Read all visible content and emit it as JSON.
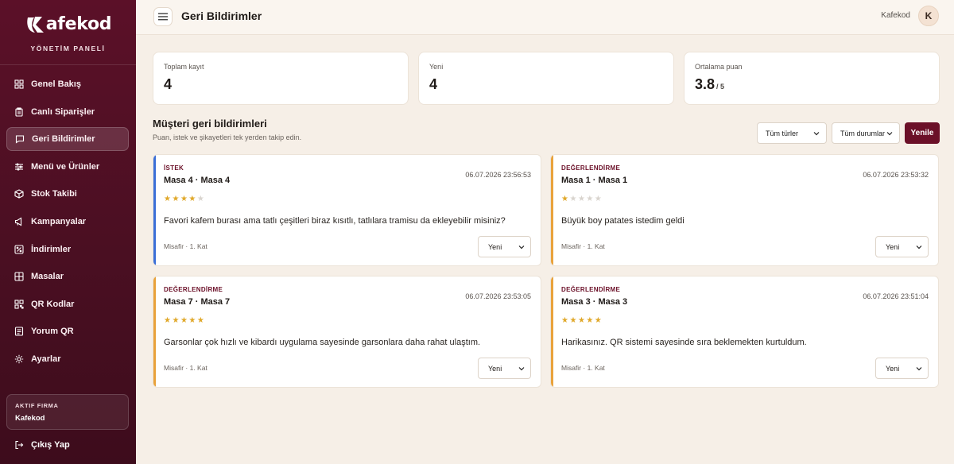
{
  "sidebar": {
    "brand": "afekod",
    "subtitle": "YÖNETİM PANELİ",
    "items": [
      {
        "label": "Genel Bakış",
        "icon": "grid-icon",
        "active": false
      },
      {
        "label": "Canlı Siparişler",
        "icon": "clipboard-icon",
        "active": false
      },
      {
        "label": "Geri Bildirimler",
        "icon": "message-icon",
        "active": true
      },
      {
        "label": "Menü ve Ürünler",
        "icon": "sliders-icon",
        "active": false
      },
      {
        "label": "Stok Takibi",
        "icon": "box-icon",
        "active": false
      },
      {
        "label": "Kampanyalar",
        "icon": "megaphone-icon",
        "active": false
      },
      {
        "label": "İndirimler",
        "icon": "discount-icon",
        "active": false
      },
      {
        "label": "Masalar",
        "icon": "table-icon",
        "active": false
      },
      {
        "label": "QR Kodlar",
        "icon": "qr-icon",
        "active": false
      },
      {
        "label": "Yorum QR",
        "icon": "comment-qr-icon",
        "active": false
      },
      {
        "label": "Ayarlar",
        "icon": "gear-icon",
        "active": false
      }
    ],
    "company_label": "AKTIF FIRMA",
    "company_name": "Kafekod",
    "logout": "Çıkış Yap"
  },
  "topbar": {
    "title": "Geri Bildirimler",
    "user": "Kafekod",
    "avatar": "K"
  },
  "stats": [
    {
      "label": "Toplam kayıt",
      "value": "4",
      "suffix": ""
    },
    {
      "label": "Yeni",
      "value": "4",
      "suffix": ""
    },
    {
      "label": "Ortalama puan",
      "value": "3.8",
      "suffix": "/ 5"
    }
  ],
  "section": {
    "title": "Müşteri geri bildirimleri",
    "subtitle": "Puan, istek ve şikayetleri tek yerden takip edin.",
    "filter_types": "Tüm türler",
    "filter_status": "Tüm durumlar",
    "refresh": "Yenile"
  },
  "cards": [
    {
      "type": "İSTEK",
      "title": "Masa 4 · Masa 4",
      "date": "06.07.2026 23:56:53",
      "rating": 4,
      "text": "Favori kafem burası ama tatlı çeşitleri biraz kısıtlı, tatlılara tramisu da ekleyebilir misiniz?",
      "meta": "Misafir · 1. Kat",
      "status": "Yeni",
      "accent": "#3b6fd8"
    },
    {
      "type": "DEĞERLENDİRME",
      "title": "Masa 1 · Masa 1",
      "date": "06.07.2026 23:53:32",
      "rating": 1,
      "text": "Büyük boy patates istedim geldi",
      "meta": "Misafir · 1. Kat",
      "status": "Yeni",
      "accent": "#e9a23b"
    },
    {
      "type": "DEĞERLENDİRME",
      "title": "Masa 7 · Masa 7",
      "date": "06.07.2026 23:53:05",
      "rating": 5,
      "text": "Garsonlar çok hızlı ve kibardı uygulama sayesinde garsonlara daha rahat ulaştım.",
      "meta": "Misafir · 1. Kat",
      "status": "Yeni",
      "accent": "#e9a23b"
    },
    {
      "type": "DEĞERLENDİRME",
      "title": "Masa 3 · Masa 3",
      "date": "06.07.2026 23:51:04",
      "rating": 5,
      "text": "Harikasınız. QR sistemi sayesinde sıra beklemekten kurtuldum.",
      "meta": "Misafir · 1. Kat",
      "status": "Yeni",
      "accent": "#e9a23b"
    }
  ]
}
